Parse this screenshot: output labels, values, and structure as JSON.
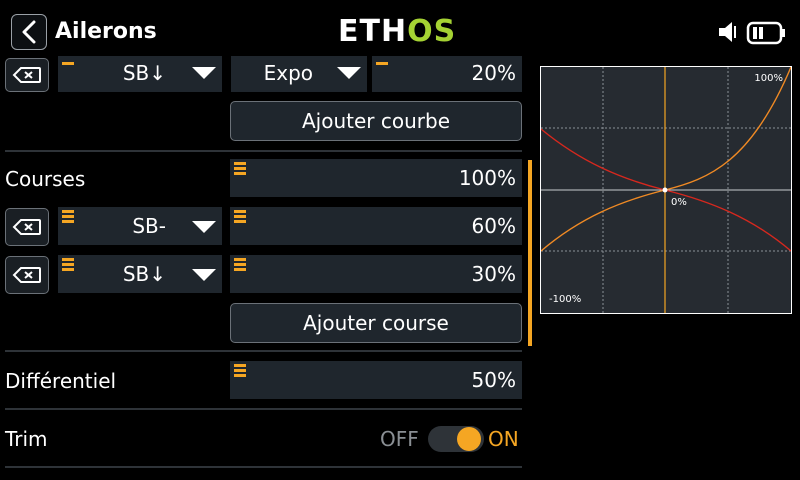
{
  "header": {
    "back_icon": "chevron-left-icon",
    "title": "Ailerons",
    "logo_left": "ETH",
    "logo_right": "OS",
    "volume_icon": "speaker-icon",
    "battery_icon": "battery-icon"
  },
  "rate_row": {
    "switch": "SB↓",
    "curve_type": "Expo",
    "value": "20%"
  },
  "add_curve_label": "Ajouter courbe",
  "courses": {
    "label": "Courses",
    "main_value": "100%",
    "rows": [
      {
        "switch": "SB-",
        "value": "60%"
      },
      {
        "switch": "SB↓",
        "value": "30%"
      }
    ],
    "add_label": "Ajouter course"
  },
  "differential": {
    "label": "Différentiel",
    "value": "50%"
  },
  "trim": {
    "label": "Trim",
    "off_label": "OFF",
    "on_label": "ON",
    "state": "on"
  },
  "graph": {
    "top_label": "100%",
    "center_label": "0%",
    "bottom_label": "-100%",
    "colors": {
      "orange": "#f08a24",
      "red": "#d6281e",
      "accent": "#f5a623"
    }
  }
}
